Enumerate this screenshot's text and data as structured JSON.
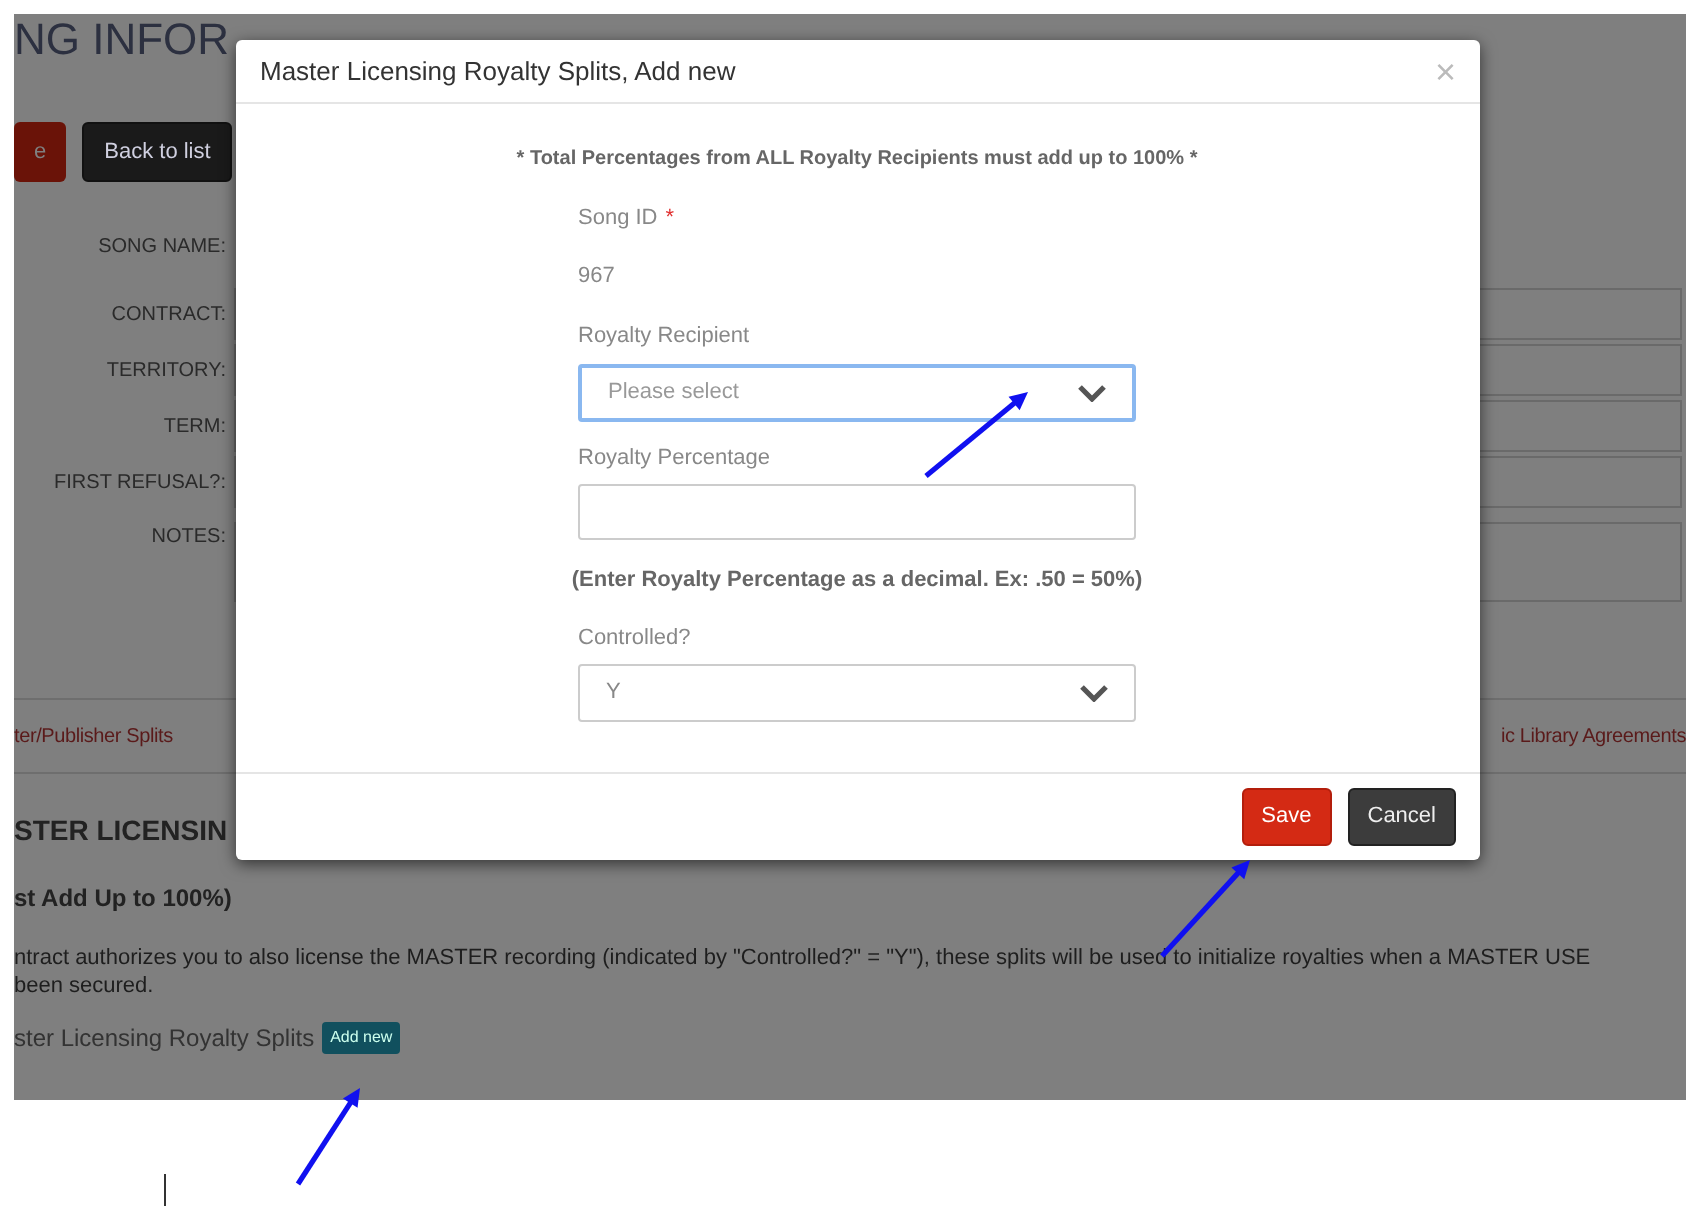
{
  "page": {
    "heading": "NG INFOR",
    "buttons": [
      {
        "label": "e",
        "kind": "danger"
      },
      {
        "label": "Back to list",
        "kind": "dark"
      }
    ],
    "fields": [
      {
        "label": "SONG NAME:",
        "kind": "large"
      },
      {
        "label": "CONTRACT:",
        "kind": "input"
      },
      {
        "label": "TERRITORY:",
        "kind": "input"
      },
      {
        "label": "TERM:",
        "kind": "input"
      },
      {
        "label": "FIRST REFUSAL?:",
        "kind": "input"
      },
      {
        "label": "NOTES:",
        "kind": "textarea"
      }
    ],
    "tabs": [
      {
        "label": "ter/Publisher Splits"
      },
      {
        "label": "ic Library Agreements"
      }
    ],
    "section_title": "STER LICENSIN",
    "subtitle": "st Add Up to 100%)",
    "description": [
      "ntract authorizes you to also license the MASTER recording (indicated by \"Controlled?\" = \"Y\"), these splits will be used to initialize royalties when a MASTER USE",
      "been secured."
    ],
    "list_label": "ster Licensing Royalty Splits",
    "add_button": "Add new"
  },
  "modal": {
    "title": "Master Licensing Royalty Splits, Add new",
    "close": "×",
    "notice": "* Total Percentages from ALL Royalty Recipients must add up to 100% *",
    "fields": [
      {
        "kind": "static",
        "label": "Song ID",
        "required_mark": "*",
        "value": "967"
      },
      {
        "kind": "select",
        "label": "Royalty Recipient",
        "placeholder": "Please select",
        "focused": true
      },
      {
        "kind": "input",
        "label": "Royalty Percentage",
        "focused": false
      },
      {
        "kind": "note",
        "text": "(Enter Royalty Percentage as a decimal. Ex: .50 = 50%)"
      },
      {
        "kind": "select",
        "label": "Controlled?",
        "value": "Y",
        "focused": false
      }
    ],
    "buttons": [
      {
        "label": "Save",
        "kind": "danger"
      },
      {
        "label": "Cancel",
        "kind": "dark"
      }
    ]
  }
}
